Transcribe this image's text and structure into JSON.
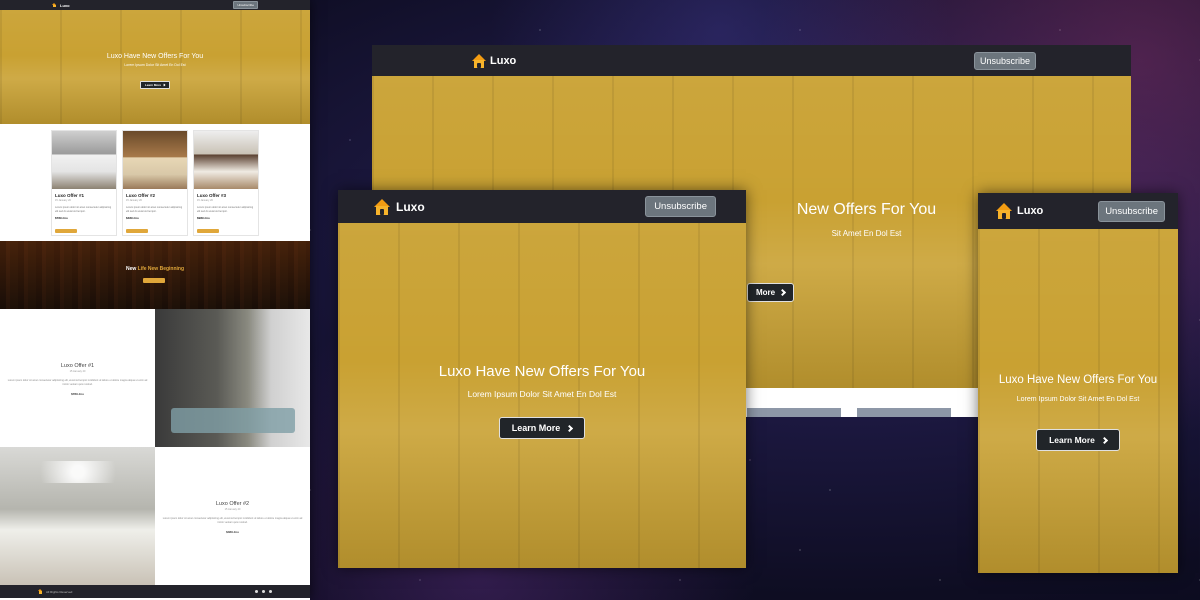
{
  "brand": {
    "name": "Luxo"
  },
  "nav": {
    "unsubscribe_label": "Unsubscribe"
  },
  "hero": {
    "title": "Luxo Have New Offers For You",
    "subtitle": "Lorem Ipsum Dolor Sit Amet En Dol Est",
    "cta_label": "Learn More"
  },
  "desktop_back": {
    "hero_title_visible": "New Offers For You",
    "hero_subtitle_visible": "Sit Amet En Dol Est",
    "cta_label": "More"
  },
  "offers": [
    {
      "title": "Luxo Offer #1",
      "date": "15 January 20",
      "desc": "Lorem ipsum dolor sit amet consectetur adipisicing elit sed do eiusmod tempor.",
      "price": "$789 /mo",
      "button": "Book Now"
    },
    {
      "title": "Luxo Offer #2",
      "date": "15 January 20",
      "desc": "Lorem ipsum dolor sit amet consectetur adipisicing elit sed do eiusmod tempor.",
      "price": "$489 /mo",
      "button": "Book Now"
    },
    {
      "title": "Luxo Offer #3",
      "date": "15 January 20",
      "desc": "Lorem ipsum dolor sit amet consectetur adipisicing elit sed do eiusmod tempor.",
      "price": "$989 /mo",
      "button": "Book Now"
    }
  ],
  "banner": {
    "title_pre": "New",
    "title_accent": "Life New",
    "title_post": "Beginning",
    "button": "Learn More"
  },
  "feature_offers": [
    {
      "title": "Luxo Offer #1",
      "date": "15 January 20",
      "desc": "Lorem ipsum dolor sit amet consectetur adipisicing elit, eiusmod tempor incididunt ut labore et dolore magna aliqua ut enim ad minim veniam quis nostrud.",
      "price": "$789 /mo"
    },
    {
      "title": "Luxo Offer #2",
      "date": "15 January 20",
      "desc": "Lorem ipsum dolor sit amet consectetur adipisicing elit, eiusmod tempor incididunt ut labore et dolore magna aliqua ut enim ad minim veniam quis nostrud.",
      "price": "$489 /mo"
    }
  ],
  "footer": {
    "copyright": "All Rights Reserved"
  },
  "colors": {
    "accent": "#e0a73a",
    "hero_overlay": "#c9a132",
    "nav_bg": "#23232b",
    "logo": "#f39c12"
  },
  "icons": [
    "house-logo-icon",
    "chevron-right-icon",
    "social-icon"
  ]
}
